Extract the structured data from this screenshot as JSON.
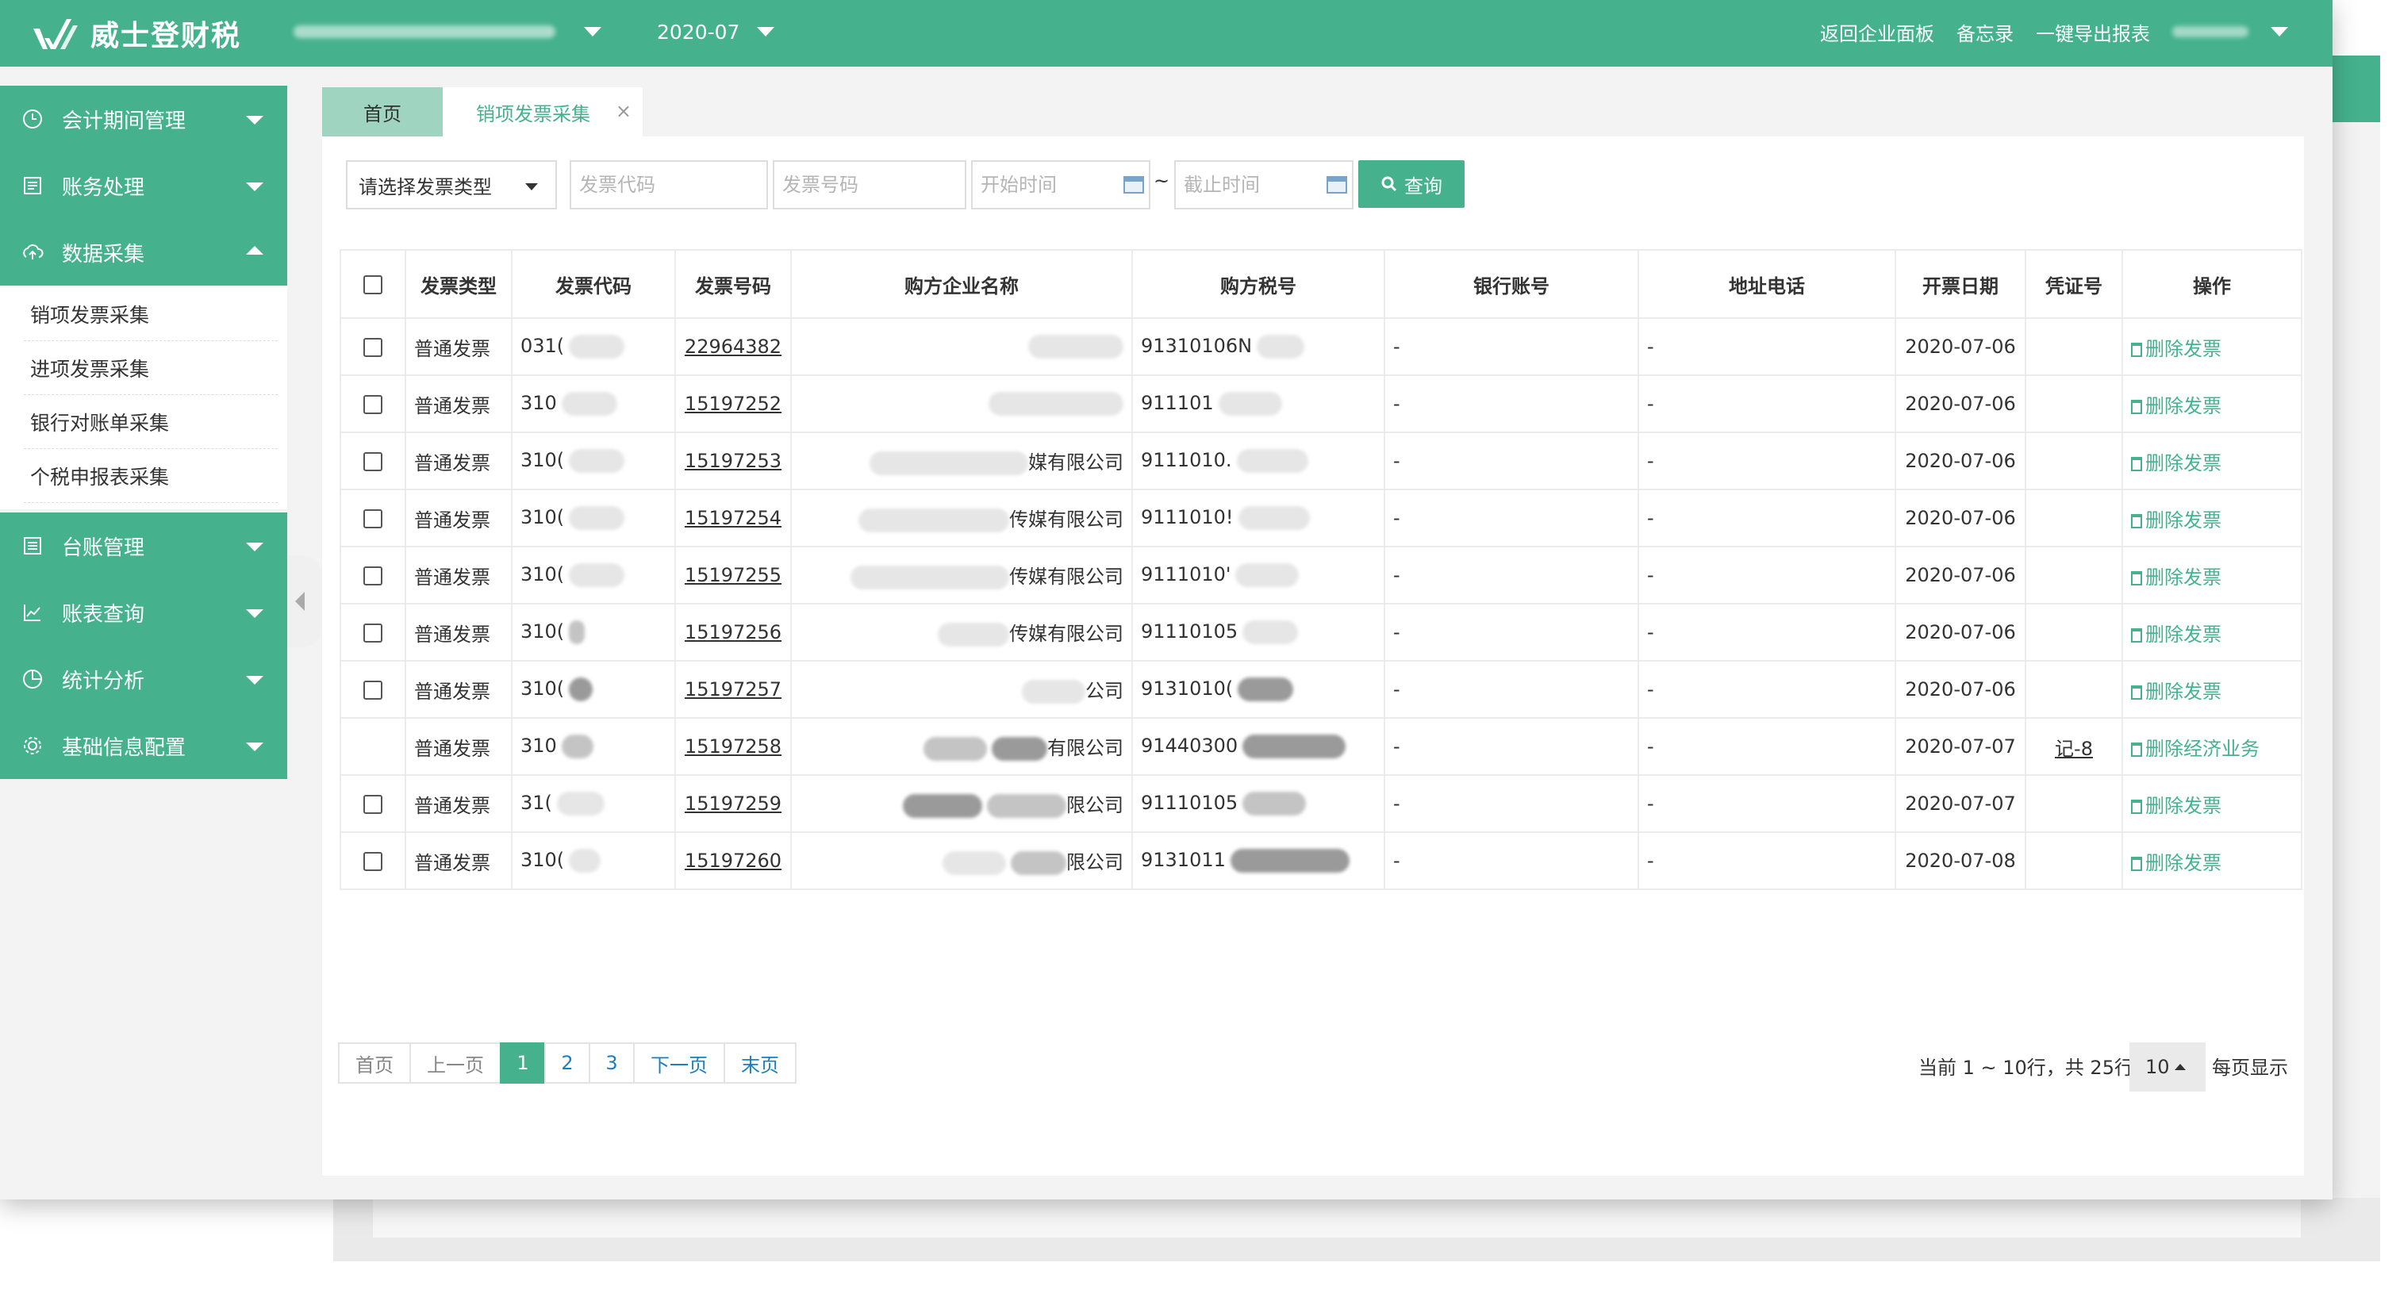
{
  "header": {
    "brand": "威士登财税",
    "period": "2020-07",
    "links": [
      "返回企业面板",
      "备忘录",
      "一键导出报表"
    ]
  },
  "sidebar": {
    "menu": [
      {
        "label": "会计期间管理",
        "icon": "clock-icon",
        "expanded": false
      },
      {
        "label": "账务处理",
        "icon": "ledger-icon",
        "expanded": false
      },
      {
        "label": "数据采集",
        "icon": "cloud-upload-icon",
        "expanded": true
      },
      {
        "label": "台账管理",
        "icon": "list-icon",
        "expanded": false
      },
      {
        "label": "账表查询",
        "icon": "line-chart-icon",
        "expanded": false
      },
      {
        "label": "统计分析",
        "icon": "pie-chart-icon",
        "expanded": false
      },
      {
        "label": "基础信息配置",
        "icon": "gear-icon",
        "expanded": false
      }
    ],
    "submenu": [
      "销项发票采集",
      "进项发票采集",
      "银行对账单采集",
      "个税申报表采集"
    ]
  },
  "tabs": {
    "home": "首页",
    "active": "销项发票采集",
    "close": "×"
  },
  "filters": {
    "invoice_type_placeholder": "请选择发票类型",
    "code_placeholder": "发票代码",
    "number_placeholder": "发票号码",
    "start_placeholder": "开始时间",
    "end_placeholder": "截止时间",
    "range_sep": "~",
    "query_label": "查询"
  },
  "table": {
    "columns": [
      "发票类型",
      "发票代码",
      "发票号码",
      "购方企业名称",
      "购方税号",
      "银行账号",
      "地址电话",
      "开票日期",
      "凭证号",
      "操作"
    ],
    "rows": [
      {
        "type": "普通发票",
        "code": "031(",
        "number": "22964382",
        "buyer": "",
        "tax_id": "91310106N",
        "bank": "-",
        "addr": "-",
        "date": "2020-07-06",
        "voucher": "",
        "op": "删除发票",
        "checkbox": true
      },
      {
        "type": "普通发票",
        "code": "310",
        "number": "15197252",
        "buyer": "",
        "tax_id": "911101",
        "bank": "-",
        "addr": "-",
        "date": "2020-07-06",
        "voucher": "",
        "op": "删除发票",
        "checkbox": true
      },
      {
        "type": "普通发票",
        "code": "310(",
        "number": "15197253",
        "buyer": "媒有限公司",
        "tax_id": "9111010.",
        "bank": "-",
        "addr": "-",
        "date": "2020-07-06",
        "voucher": "",
        "op": "删除发票",
        "checkbox": true
      },
      {
        "type": "普通发票",
        "code": "310(",
        "number": "15197254",
        "buyer": "传媒有限公司",
        "tax_id": "9111010!",
        "bank": "-",
        "addr": "-",
        "date": "2020-07-06",
        "voucher": "",
        "op": "删除发票",
        "checkbox": true
      },
      {
        "type": "普通发票",
        "code": "310(",
        "number": "15197255",
        "buyer": "传媒有限公司",
        "tax_id": "9111010'",
        "bank": "-",
        "addr": "-",
        "date": "2020-07-06",
        "voucher": "",
        "op": "删除发票",
        "checkbox": true
      },
      {
        "type": "普通发票",
        "code": "310(",
        "number": "15197256",
        "buyer": "传媒有限公司",
        "tax_id": "91110105",
        "bank": "-",
        "addr": "-",
        "date": "2020-07-06",
        "voucher": "",
        "op": "删除发票",
        "checkbox": true
      },
      {
        "type": "普通发票",
        "code": "310(",
        "number": "15197257",
        "buyer": "公司",
        "tax_id": "9131010(",
        "bank": "-",
        "addr": "-",
        "date": "2020-07-06",
        "voucher": "",
        "op": "删除发票",
        "checkbox": true
      },
      {
        "type": "普通发票",
        "code": "310",
        "number": "15197258",
        "buyer": "有限公司",
        "tax_id": "91440300",
        "bank": "-",
        "addr": "-",
        "date": "2020-07-07",
        "voucher": "记-8",
        "op": "删除经济业务",
        "checkbox": false
      },
      {
        "type": "普通发票",
        "code": "31(",
        "number": "15197259",
        "buyer": "限公司",
        "tax_id": "91110105",
        "bank": "-",
        "addr": "-",
        "date": "2020-07-07",
        "voucher": "",
        "op": "删除发票",
        "checkbox": true
      },
      {
        "type": "普通发票",
        "code": "310(",
        "number": "15197260",
        "buyer": "限公司",
        "tax_id": "9131011",
        "bank": "-",
        "addr": "-",
        "date": "2020-07-08",
        "voucher": "",
        "op": "删除发票",
        "checkbox": true
      }
    ]
  },
  "pager": {
    "first": "首页",
    "prev": "上一页",
    "pages": [
      "1",
      "2",
      "3"
    ],
    "current": "1",
    "next": "下一页",
    "last": "末页",
    "info": "当前 1 ~ 10行，共 25行",
    "page_size": "10",
    "per_page_label": "每页显示"
  },
  "colors": {
    "accent": "#45b28d",
    "link_blue": "#1a7fc1"
  }
}
